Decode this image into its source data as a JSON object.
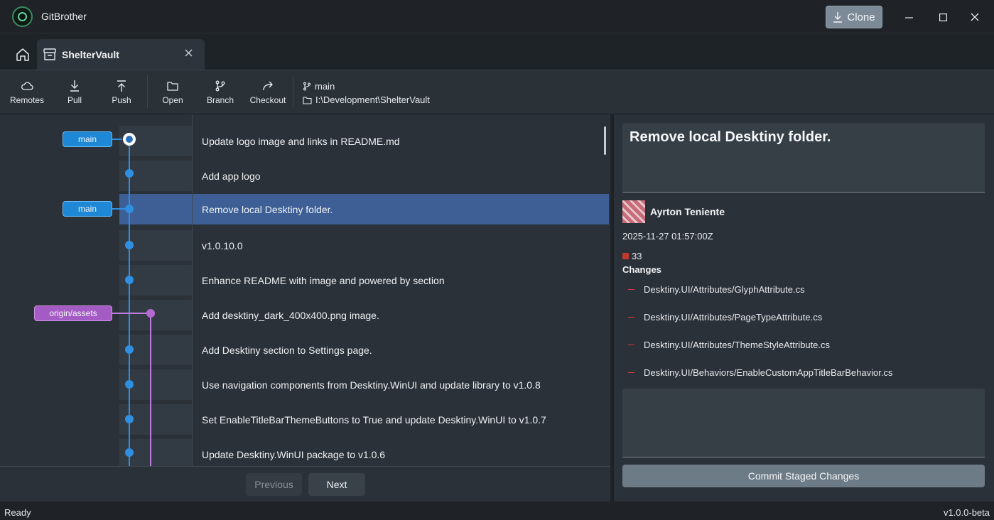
{
  "app": {
    "title": "GitBrother"
  },
  "titlebar": {
    "clone_label": "Clone",
    "minimize_glyph": "—",
    "maximize_glyph": "☐",
    "close_glyph": "✕"
  },
  "tabs": {
    "home_icon": "home-icon",
    "repo_tab": {
      "label": "ShelterVault",
      "icon": "archive-icon",
      "close_glyph": "✕"
    }
  },
  "toolbar": {
    "remotes": "Remotes",
    "pull": "Pull",
    "push": "Push",
    "open": "Open",
    "branch": "Branch",
    "checkout": "Checkout",
    "current_branch": "main",
    "repo_path": "I:\\Development\\ShelterVault"
  },
  "graph": {
    "tags": [
      {
        "label": "main",
        "color": "#1e88d6"
      },
      {
        "label": "main",
        "color": "#1e88d6"
      },
      {
        "label": "origin/assets",
        "color": "#a55bc4"
      }
    ]
  },
  "commits": [
    {
      "message": "Update logo image and links in README.md",
      "selected": false
    },
    {
      "message": "Add app logo",
      "selected": false
    },
    {
      "message": "Remove local Desktiny folder.",
      "selected": true
    },
    {
      "message": "v1.0.10.0",
      "selected": false
    },
    {
      "message": "Enhance README with image and powered by section",
      "selected": false
    },
    {
      "message": "Add desktiny_dark_400x400.png image.",
      "selected": false
    },
    {
      "message": "Add Desktiny section to Settings page.",
      "selected": false
    },
    {
      "message": "Use navigation components from Desktiny.WinUI and update library to v1.0.8",
      "selected": false
    },
    {
      "message": "Set EnableTitleBarThemeButtons to True and update Desktiny.WinUI to v1.0.7",
      "selected": false
    },
    {
      "message": "Update Desktiny.WinUI package to v1.0.6",
      "selected": false
    }
  ],
  "pagination": {
    "previous": "Previous",
    "next": "Next"
  },
  "details": {
    "message": "Remove local Desktiny folder.",
    "author": "Ayrton Teniente",
    "date": "2025-11-27 01:57:00Z",
    "change_count": "33",
    "changes_heading": "Changes",
    "changes": [
      "Desktiny.UI/Attributes/GlyphAttribute.cs",
      "Desktiny.UI/Attributes/PageTypeAttribute.cs",
      "Desktiny.UI/Attributes/ThemeStyleAttribute.cs",
      "Desktiny.UI/Behaviors/EnableCustomAppTitleBarBehavior.cs"
    ],
    "commit_button": "Commit Staged Changes",
    "colors": {
      "deleted": "#d33d3d",
      "selection": "#3d5f96"
    }
  },
  "statusbar": {
    "status": "Ready",
    "version": "v1.0.0-beta"
  }
}
